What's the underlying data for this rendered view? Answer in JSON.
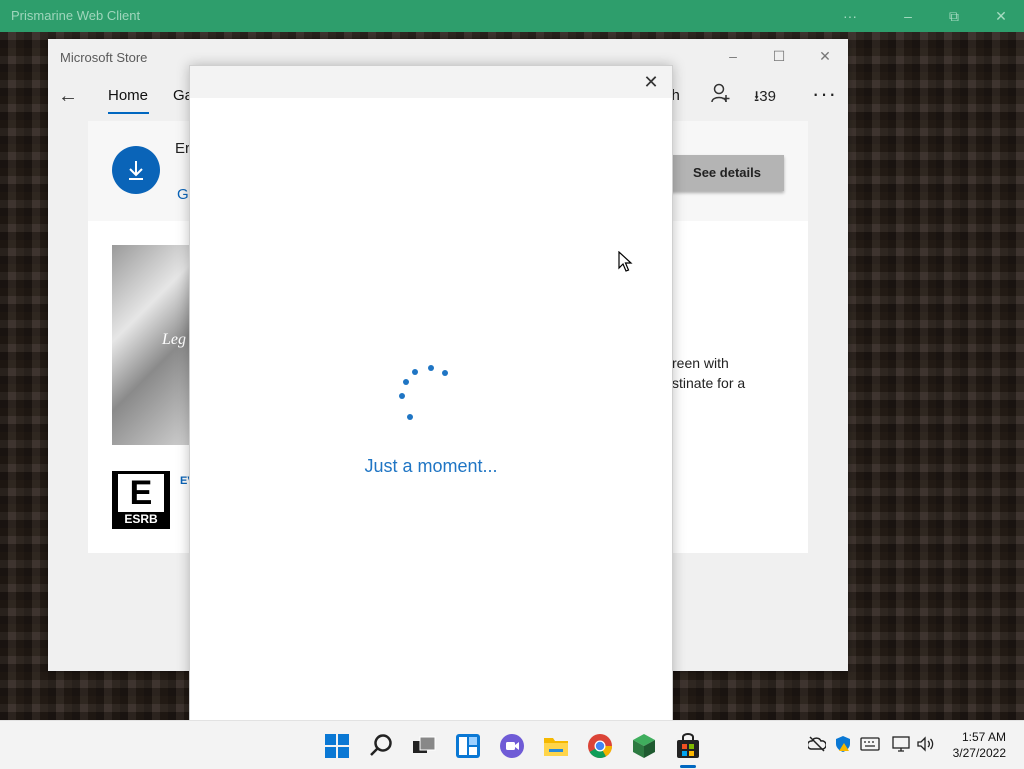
{
  "host_window": {
    "title": "Prismarine Web Client",
    "more_label": "···",
    "minimize_label": "–",
    "restore_label": "⧉",
    "close_label": "✕"
  },
  "store_window": {
    "title": "Microsoft Store",
    "minimize_label": "–",
    "maximize_label": "☐",
    "close_label": "✕",
    "nav": {
      "back_label": "←",
      "home_label": "Home",
      "games_partial": "Ga",
      "search_partial": "ch",
      "downloads_count": "39"
    },
    "banner": {
      "item_name_partial": "Er",
      "go_link_partial": "G",
      "see_details_label": "See details"
    },
    "content": {
      "cover_text_partial": "Leg",
      "esrb_rating": "E",
      "esrb_label": "ESRB",
      "rating_link_partial": "EV",
      "description_line1": "reen with",
      "description_line2": "stinate for a"
    }
  },
  "dialog": {
    "close_label": "✕",
    "loading_text": "Just a moment..."
  },
  "taskbar": {
    "icons": [
      "windows-start-icon",
      "search-icon",
      "task-view-icon",
      "widgets-icon",
      "chat-icon",
      "file-explorer-icon",
      "chrome-icon",
      "minecraft-icon",
      "microsoft-store-icon"
    ],
    "clock": {
      "time": "1:57 AM",
      "date": "3/27/2022"
    }
  },
  "colors": {
    "host_titlebar": "#2e9e6c",
    "accent": "#0067c0",
    "loading_text": "#1f75c4"
  }
}
